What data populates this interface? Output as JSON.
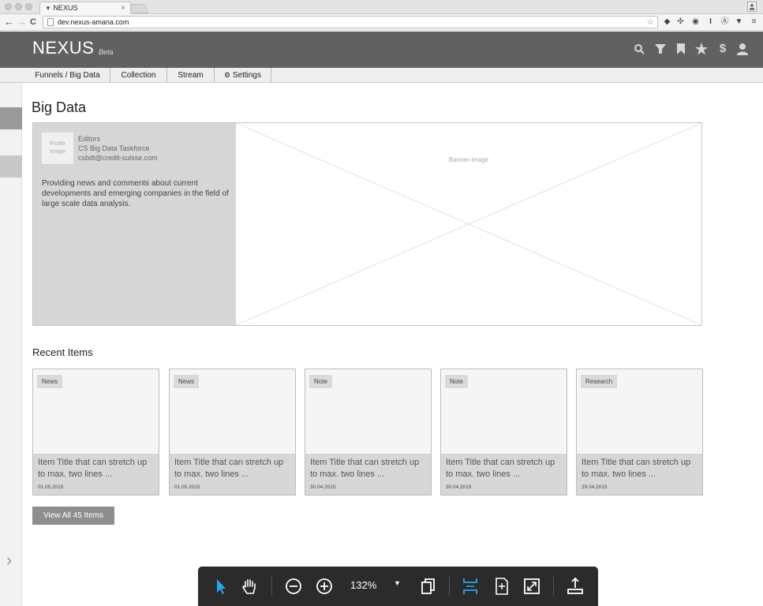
{
  "browser": {
    "tab_title": "NEXUS",
    "tab_close": "×",
    "url": "dev.nexus-amana.com",
    "back": "←",
    "forward": "→",
    "reload": "C",
    "star": "☆"
  },
  "app": {
    "brand": "NEXUS",
    "beta": "Beta",
    "header_icons": [
      "search-icon",
      "filter-icon",
      "bookmark-icon",
      "star-icon",
      "dollar-icon",
      "user-icon"
    ]
  },
  "subnav": [
    {
      "label": "Funnels / Big Data"
    },
    {
      "label": "Collection"
    },
    {
      "label": "Stream"
    },
    {
      "label": "Settings",
      "icon": "gears-icon"
    }
  ],
  "page": {
    "title": "Big Data"
  },
  "hero": {
    "profile_image": "Profile Image",
    "role": "Editors",
    "name": "CS Big Data Taskforce",
    "email": "csbdt@credit-suisse.com",
    "description": "Providing news and comments about current developments and emerging companies in the field of large scale data analysis.",
    "banner_label": "Banner-image"
  },
  "recent": {
    "heading": "Recent Items",
    "items": [
      {
        "badge": "News",
        "title": "Item Title that can stretch up to max. two lines ...",
        "date": "01.05.2015"
      },
      {
        "badge": "News",
        "title": "Item Title that can stretch up to max. two lines ...",
        "date": "01.05.2015"
      },
      {
        "badge": "Note",
        "title": "Item Title that can stretch up to max. two lines ...",
        "date": "30.04.2015"
      },
      {
        "badge": "Note",
        "title": "Item Title that can stretch up to max. two lines ...",
        "date": "30.04.2015"
      },
      {
        "badge": "Research",
        "title": "Item Title that can stretch up to max. two lines ...",
        "date": "29.04.2015"
      }
    ],
    "view_all": "View All 45 Items"
  },
  "toolbar": {
    "zoom": "132%",
    "active_color": "#2aa7e8"
  }
}
